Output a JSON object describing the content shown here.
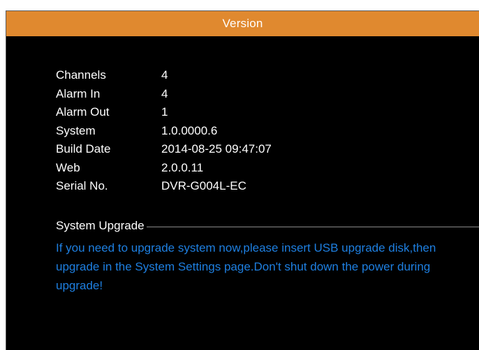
{
  "window": {
    "title": "Version"
  },
  "info": [
    {
      "label": "Channels",
      "value": "4"
    },
    {
      "label": "Alarm In",
      "value": "4"
    },
    {
      "label": "Alarm Out",
      "value": "1"
    },
    {
      "label": "System",
      "value": "1.0.0000.6"
    },
    {
      "label": "Build Date",
      "value": "2014-08-25 09:47:07"
    },
    {
      "label": "Web",
      "value": "2.0.0.11"
    },
    {
      "label": "Serial No.",
      "value": "DVR-G004L-EC"
    }
  ],
  "upgrade": {
    "title": "System Upgrade",
    "message": "If you need to upgrade system now,please insert USB upgrade disk,then upgrade in the System Settings page.Don't shut down the power during upgrade!"
  },
  "colors": {
    "titlebar": "#e0892f",
    "background": "#000000",
    "text": "#ffffff",
    "notice": "#1e7fe0"
  }
}
